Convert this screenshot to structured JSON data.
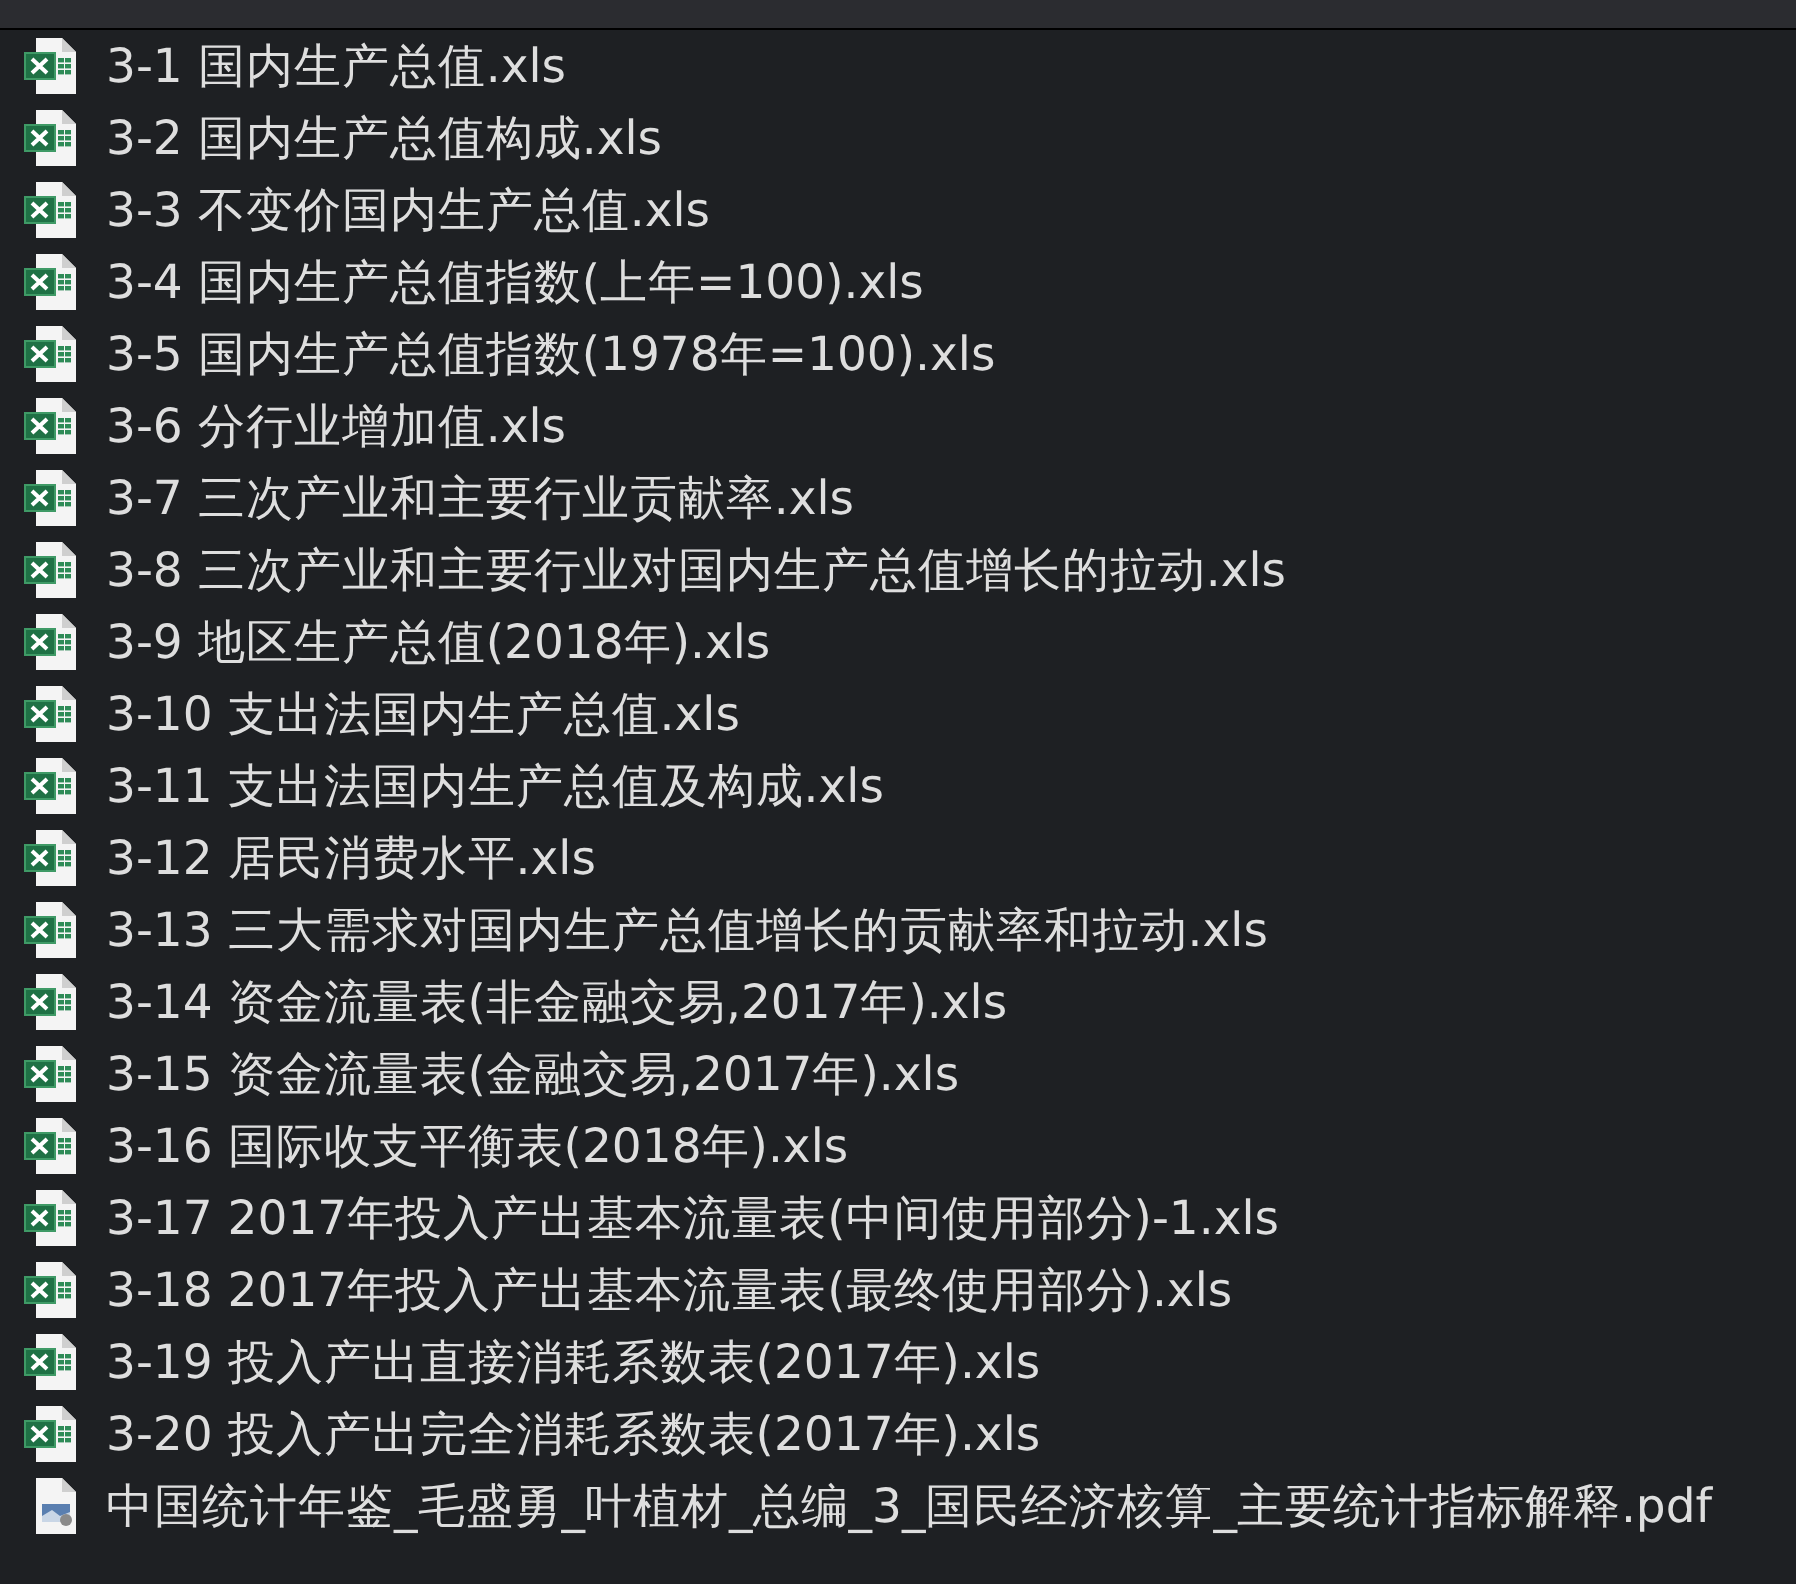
{
  "files": [
    {
      "kind": "spreadsheet",
      "name": "3-1 国内生产总值.xls"
    },
    {
      "kind": "spreadsheet",
      "name": "3-2 国内生产总值构成.xls"
    },
    {
      "kind": "spreadsheet",
      "name": "3-3 不变价国内生产总值.xls"
    },
    {
      "kind": "spreadsheet",
      "name": "3-4 国内生产总值指数(上年=100).xls"
    },
    {
      "kind": "spreadsheet",
      "name": "3-5 国内生产总值指数(1978年=100).xls"
    },
    {
      "kind": "spreadsheet",
      "name": "3-6 分行业增加值.xls"
    },
    {
      "kind": "spreadsheet",
      "name": "3-7 三次产业和主要行业贡献率.xls"
    },
    {
      "kind": "spreadsheet",
      "name": "3-8 三次产业和主要行业对国内生产总值增长的拉动.xls"
    },
    {
      "kind": "spreadsheet",
      "name": "3-9 地区生产总值(2018年).xls"
    },
    {
      "kind": "spreadsheet",
      "name": "3-10 支出法国内生产总值.xls"
    },
    {
      "kind": "spreadsheet",
      "name": "3-11 支出法国内生产总值及构成.xls"
    },
    {
      "kind": "spreadsheet",
      "name": "3-12 居民消费水平.xls"
    },
    {
      "kind": "spreadsheet",
      "name": "3-13 三大需求对国内生产总值增长的贡献率和拉动.xls"
    },
    {
      "kind": "spreadsheet",
      "name": "3-14 资金流量表(非金融交易,2017年).xls"
    },
    {
      "kind": "spreadsheet",
      "name": "3-15 资金流量表(金融交易,2017年).xls"
    },
    {
      "kind": "spreadsheet",
      "name": "3-16 国际收支平衡表(2018年).xls"
    },
    {
      "kind": "spreadsheet",
      "name": "3-17 2017年投入产出基本流量表(中间使用部分)-1.xls"
    },
    {
      "kind": "spreadsheet",
      "name": "3-18 2017年投入产出基本流量表(最终使用部分).xls"
    },
    {
      "kind": "spreadsheet",
      "name": "3-19 投入产出直接消耗系数表(2017年).xls"
    },
    {
      "kind": "spreadsheet",
      "name": "3-20 投入产出完全消耗系数表(2017年).xls"
    },
    {
      "kind": "pdf",
      "name": "中国统计年鉴_毛盛勇_叶植材_总编_3_国民经济核算_主要统计指标解释.pdf"
    }
  ]
}
